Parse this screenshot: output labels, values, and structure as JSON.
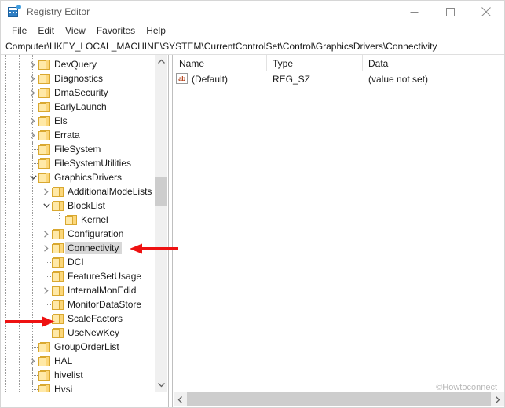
{
  "window": {
    "title": "Registry Editor",
    "icon": "registry-editor-icon",
    "minimize_label": "─",
    "maximize_label": "□",
    "close_label": "✕"
  },
  "menu": {
    "items": [
      {
        "label": "File",
        "name": "menu-file"
      },
      {
        "label": "Edit",
        "name": "menu-edit"
      },
      {
        "label": "View",
        "name": "menu-view"
      },
      {
        "label": "Favorites",
        "name": "menu-favorites"
      },
      {
        "label": "Help",
        "name": "menu-help"
      }
    ]
  },
  "address": {
    "path": "Computer\\HKEY_LOCAL_MACHINE\\SYSTEM\\CurrentControlSet\\Control\\GraphicsDrivers\\Connectivity"
  },
  "tree": {
    "items": [
      {
        "label": "DevQuery",
        "indent": 0,
        "marker": "chevron",
        "selected": false
      },
      {
        "label": "Diagnostics",
        "indent": 0,
        "marker": "chevron",
        "selected": false
      },
      {
        "label": "DmaSecurity",
        "indent": 0,
        "marker": "chevron",
        "selected": false
      },
      {
        "label": "EarlyLaunch",
        "indent": 0,
        "marker": "stub",
        "selected": false
      },
      {
        "label": "Els",
        "indent": 0,
        "marker": "chevron",
        "selected": false
      },
      {
        "label": "Errata",
        "indent": 0,
        "marker": "chevron",
        "selected": false
      },
      {
        "label": "FileSystem",
        "indent": 0,
        "marker": "stub",
        "selected": false
      },
      {
        "label": "FileSystemUtilities",
        "indent": 0,
        "marker": "stub",
        "selected": false
      },
      {
        "label": "GraphicsDrivers",
        "indent": 0,
        "marker": "chevron-down",
        "selected": false
      },
      {
        "label": "AdditionalModeLists",
        "indent": 1,
        "marker": "chevron",
        "selected": false
      },
      {
        "label": "BlockList",
        "indent": 1,
        "marker": "chevron-down",
        "selected": false
      },
      {
        "label": "Kernel",
        "indent": 2,
        "marker": "stub",
        "selected": false
      },
      {
        "label": "Configuration",
        "indent": 1,
        "marker": "chevron",
        "selected": false
      },
      {
        "label": "Connectivity",
        "indent": 1,
        "marker": "chevron",
        "selected": true
      },
      {
        "label": "DCI",
        "indent": 1,
        "marker": "stub",
        "selected": false
      },
      {
        "label": "FeatureSetUsage",
        "indent": 1,
        "marker": "stub",
        "selected": false
      },
      {
        "label": "InternalMonEdid",
        "indent": 1,
        "marker": "chevron",
        "selected": false
      },
      {
        "label": "MonitorDataStore",
        "indent": 1,
        "marker": "stub",
        "selected": false
      },
      {
        "label": "ScaleFactors",
        "indent": 1,
        "marker": "stub",
        "selected": false
      },
      {
        "label": "UseNewKey",
        "indent": 1,
        "marker": "stub",
        "selected": false
      },
      {
        "label": "GroupOrderList",
        "indent": 0,
        "marker": "stub",
        "selected": false
      },
      {
        "label": "HAL",
        "indent": 0,
        "marker": "chevron",
        "selected": false
      },
      {
        "label": "hivelist",
        "indent": 0,
        "marker": "stub",
        "selected": false
      },
      {
        "label": "Hvsi",
        "indent": 0,
        "marker": "stub",
        "selected": false
      }
    ]
  },
  "values_list": {
    "columns": [
      {
        "label": "Name",
        "name": "column-header-name"
      },
      {
        "label": "Type",
        "name": "column-header-type"
      },
      {
        "label": "Data",
        "name": "column-header-data"
      }
    ],
    "rows": [
      {
        "icon": "string-value-icon",
        "icon_text": "ab",
        "name": "(Default)",
        "type": "REG_SZ",
        "data": "(value not set)"
      }
    ]
  },
  "annotations": [
    {
      "name": "arrow-pointing-to-connectivity",
      "direction": "left",
      "color": "#ee1111"
    },
    {
      "name": "arrow-pointing-to-scalefactors",
      "direction": "right",
      "color": "#ee1111"
    }
  ],
  "watermark": {
    "text": "©Howtoconnect"
  },
  "scrollbars": {
    "tree_vertical_up": "∧",
    "tree_vertical_down": "∨",
    "left_arrow": "‹",
    "right_arrow": "›"
  }
}
